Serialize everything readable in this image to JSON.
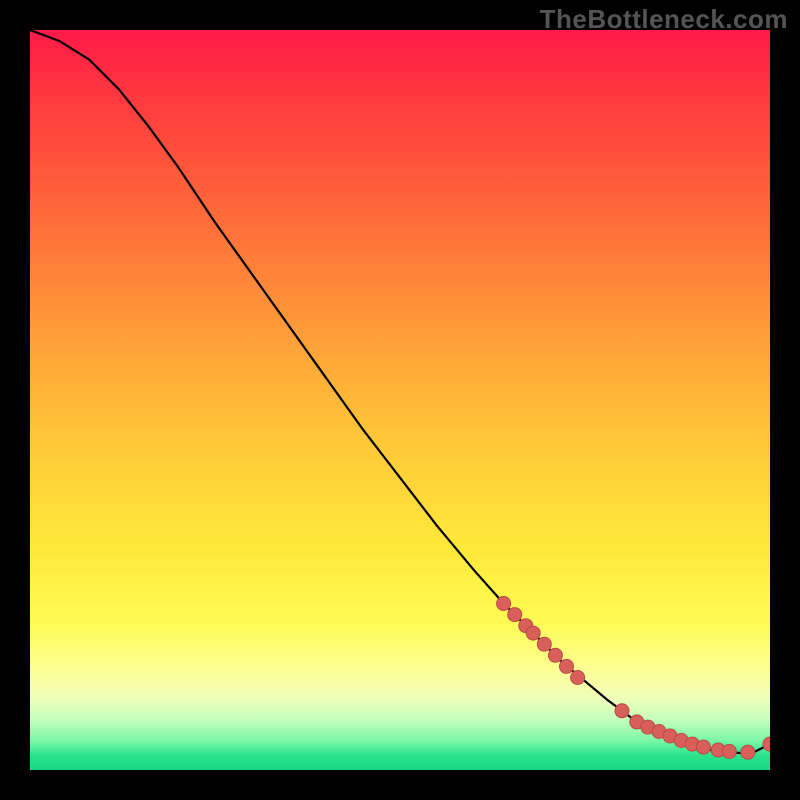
{
  "watermark": "TheBottleneck.com",
  "colors": {
    "marker_fill": "#d9605a",
    "marker_stroke": "#b84a44",
    "curve": "#000000"
  },
  "chart_data": {
    "type": "line",
    "title": "",
    "xlabel": "",
    "ylabel": "",
    "xlim": [
      0,
      100
    ],
    "ylim": [
      0,
      100
    ],
    "grid": false,
    "legend": false,
    "series": [
      {
        "name": "bottleneck-curve",
        "x": [
          0,
          4,
          8,
          12,
          16,
          20,
          25,
          30,
          35,
          40,
          45,
          50,
          55,
          60,
          64,
          68,
          72,
          75,
          78,
          80,
          82,
          84,
          86,
          88,
          90,
          92,
          94,
          96,
          98,
          100
        ],
        "y": [
          100,
          98.5,
          96,
          92,
          87,
          81.5,
          74,
          67,
          60,
          53,
          46,
          39.5,
          33,
          27,
          22.5,
          18.5,
          14.5,
          12,
          9.5,
          8,
          6.5,
          5.5,
          4.5,
          3.8,
          3.2,
          2.7,
          2.4,
          2.3,
          2.5,
          3.5
        ]
      }
    ],
    "markers": {
      "name": "highlighted-points",
      "x": [
        64,
        65.5,
        67,
        68,
        69.5,
        71,
        72.5,
        74,
        80,
        82,
        83.5,
        85,
        86.5,
        88,
        89.5,
        91,
        93,
        94.5,
        97,
        100
      ],
      "y": [
        22.5,
        21,
        19.5,
        18.5,
        17,
        15.5,
        14,
        12.5,
        8,
        6.5,
        5.8,
        5.2,
        4.6,
        4,
        3.5,
        3.1,
        2.7,
        2.5,
        2.4,
        3.5
      ]
    }
  }
}
